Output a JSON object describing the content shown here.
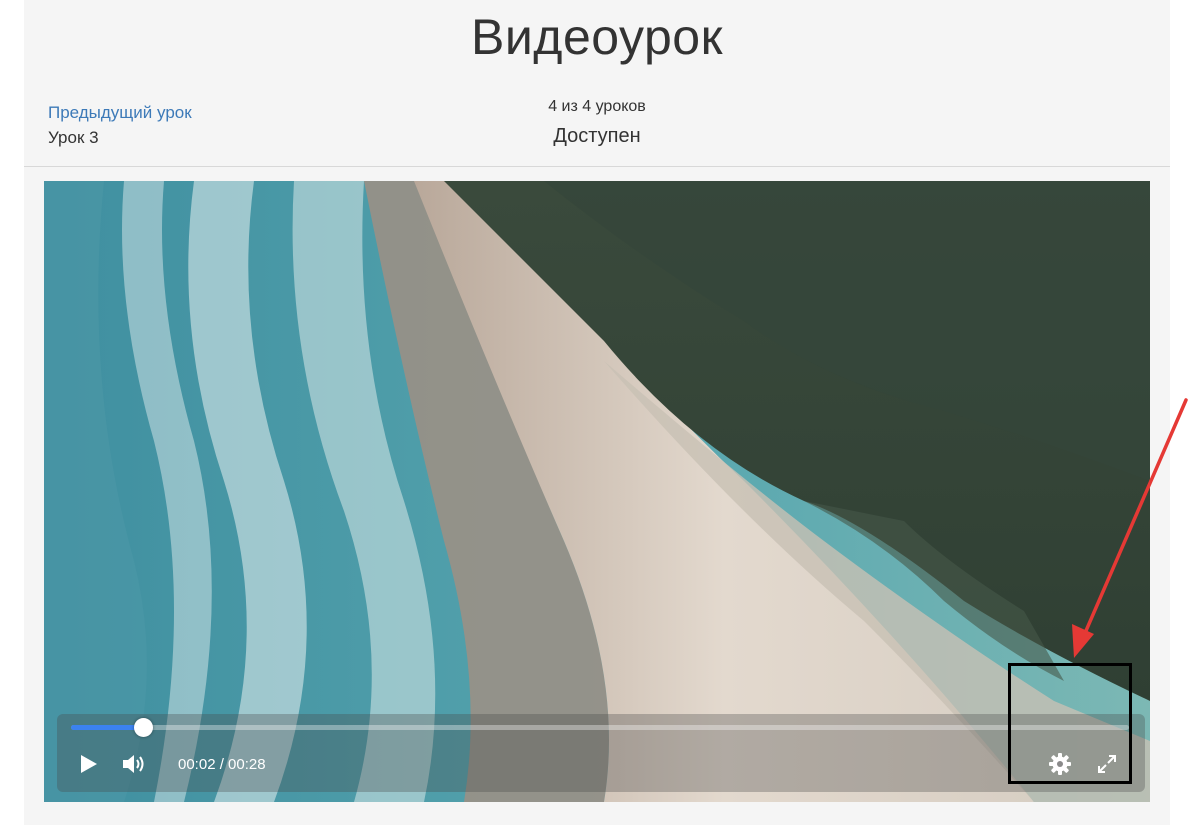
{
  "header": {
    "title": "Видеоурок",
    "prev_link": "Предыдущий урок",
    "prev_lesson": "Урок 3",
    "counter": "4 из 4 уроков",
    "status": "Доступен"
  },
  "player": {
    "progress_fraction": 0.068,
    "time": "00:02 / 00:28",
    "icons": {
      "play": "play-icon",
      "volume": "volume-icon",
      "settings": "gear-icon",
      "fullscreen": "fullscreen-icon"
    },
    "accent_color": "#3b82f0"
  },
  "annotation": {
    "arrow_color": "#e53935",
    "box_color": "#000000"
  }
}
